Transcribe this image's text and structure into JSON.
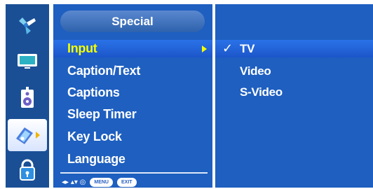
{
  "sidebar": {
    "icons": [
      {
        "name": "picture-icon"
      },
      {
        "name": "screen-icon"
      },
      {
        "name": "audio-icon"
      },
      {
        "name": "special-tag-icon"
      },
      {
        "name": "lock-icon"
      }
    ],
    "active_index": 3
  },
  "menu": {
    "title": "Special",
    "items": [
      {
        "label": "Input"
      },
      {
        "label": "Caption/Text"
      },
      {
        "label": "Captions"
      },
      {
        "label": "Sleep Timer"
      },
      {
        "label": "Key Lock"
      },
      {
        "label": "Language"
      }
    ],
    "selected_index": 0
  },
  "footer": {
    "nav_arrows": "◂▸ ▴▾ ◎",
    "menu_btn": "MENU",
    "exit_btn": "EXIT"
  },
  "submenu": {
    "check_mark": "✓",
    "items": [
      {
        "label": "TV"
      },
      {
        "label": "Video"
      },
      {
        "label": "S-Video"
      }
    ],
    "selected_index": 0
  },
  "colors": {
    "panel_bg": "#1e5fc0",
    "strip_bg": "#1a4f95",
    "highlight_text": "#f4ff00"
  }
}
